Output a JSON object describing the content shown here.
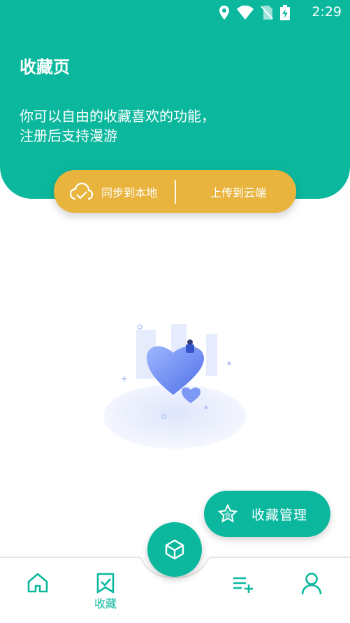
{
  "status_bar": {
    "time": "2:29"
  },
  "header": {
    "title": "收藏页",
    "subtitle": "你可以自由的收藏喜欢的功能，注册后支持漫游"
  },
  "sync": {
    "left_label": "同步到本地",
    "right_label": "上传到云端"
  },
  "fab": {
    "label": "收藏管理"
  },
  "tabs": [
    {
      "name": "home",
      "label": ""
    },
    {
      "name": "favorites",
      "label": "收藏"
    },
    {
      "name": "center",
      "label": ""
    },
    {
      "name": "playlist",
      "label": ""
    },
    {
      "name": "profile",
      "label": ""
    }
  ],
  "colors": {
    "primary": "#0bb89e",
    "accent": "#e8b43e"
  }
}
